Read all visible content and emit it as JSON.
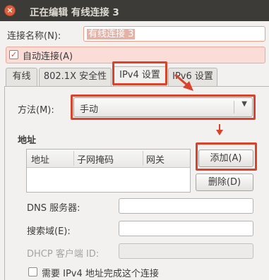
{
  "window": {
    "title": "正在编辑 有线连接 3",
    "close_glyph": "×"
  },
  "connection_name": {
    "label": "连接名称(N):",
    "value": "有线连接 3"
  },
  "autoconnect": {
    "label": "自动连接(A)",
    "checked": true,
    "check_glyph": "✓"
  },
  "tabs": [
    {
      "label": "有线",
      "active": false
    },
    {
      "label": "802.1X 安全性",
      "active": false
    },
    {
      "label": "IPv4 设置",
      "active": true
    },
    {
      "label": "IPv6 设置",
      "active": false
    }
  ],
  "method": {
    "label": "方法(M):",
    "value": "手动",
    "arrow_glyph": "▼"
  },
  "addresses": {
    "section_title": "地址",
    "columns": [
      "地址",
      "子网掩码",
      "网关"
    ],
    "rows": [],
    "add_button": "添加(A)",
    "delete_button": "删除(D)"
  },
  "dns": {
    "label": "DNS 服务器:",
    "value": ""
  },
  "search_domains": {
    "label": "搜索域(E):",
    "value": ""
  },
  "dhcp_client_id": {
    "label": "DHCP 客户端 ID:",
    "value": "",
    "disabled": true
  },
  "require_ipv4": {
    "label": "需要 IPv4 地址完成这个连接",
    "checked": false
  },
  "annotation": {
    "color": "#d9432b"
  }
}
